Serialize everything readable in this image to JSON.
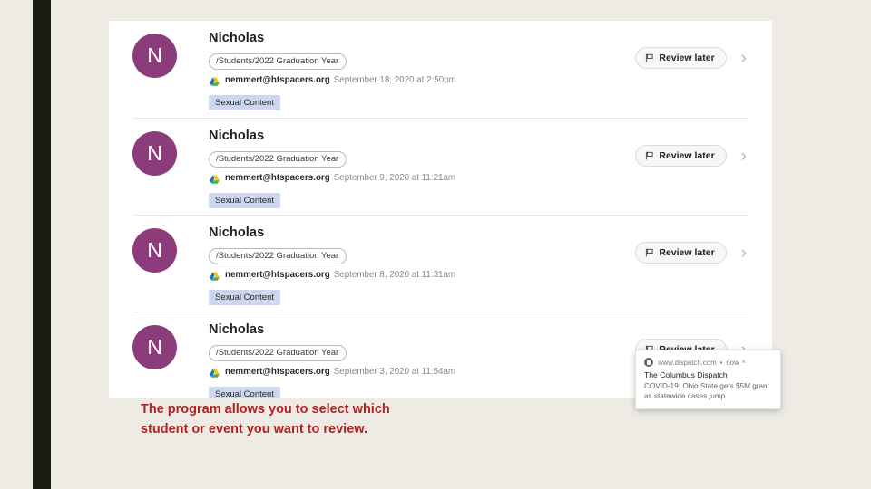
{
  "slide": {
    "caption": "The program allows you to select which student or event you want to review.",
    "accent_color": "#b22222",
    "background_color": "#edebe4",
    "sidebar_color": "#1a1c10"
  },
  "card": {
    "rows": [
      {
        "avatar_initial": "N",
        "avatar_color": "#8c3b7b",
        "name": "Nicholas",
        "path": "/Students/2022 Graduation Year",
        "email": "nemmert@htspacers.org",
        "date": "September 18, 2020 at 2:50pm",
        "tag": "Sexual Content",
        "action_label": "Review later",
        "chevron": "›"
      },
      {
        "avatar_initial": "N",
        "avatar_color": "#8c3b7b",
        "name": "Nicholas",
        "path": "/Students/2022 Graduation Year",
        "email": "nemmert@htspacers.org",
        "date": "September 9, 2020 at 11:21am",
        "tag": "Sexual Content",
        "action_label": "Review later",
        "chevron": "›"
      },
      {
        "avatar_initial": "N",
        "avatar_color": "#8c3b7b",
        "name": "Nicholas",
        "path": "/Students/2022 Graduation Year",
        "email": "nemmert@htspacers.org",
        "date": "September 8, 2020 at 11:31am",
        "tag": "Sexual Content",
        "action_label": "Review later",
        "chevron": "›"
      },
      {
        "avatar_initial": "N",
        "avatar_color": "#8c3b7b",
        "name": "Nicholas",
        "path": "/Students/2022 Graduation Year",
        "email": "nemmert@htspacers.org",
        "date": "September 3, 2020 at 11:54am",
        "tag": "Sexual Content",
        "action_label": "Review later",
        "chevron": "›"
      }
    ]
  },
  "toast": {
    "source": "www.dispatch.com",
    "separator": "•",
    "time": "now",
    "caret": "˄",
    "title": "The Columbus Dispatch",
    "body": "COVID-19: Ohio State gets $5M grant as statewide cases jump"
  }
}
